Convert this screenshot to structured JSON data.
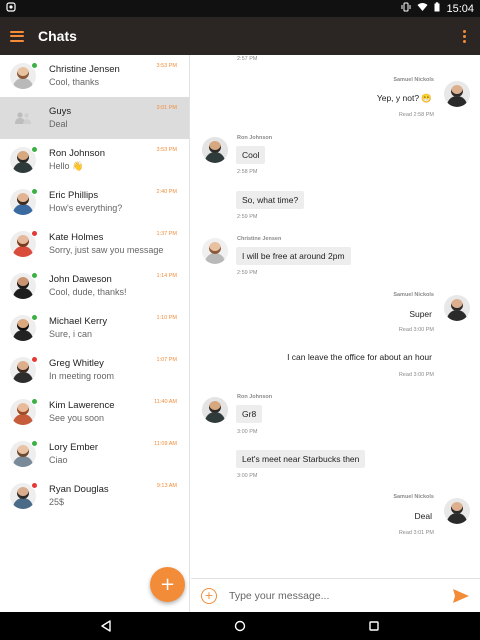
{
  "status_bar": {
    "time": "15:04"
  },
  "app_bar": {
    "title": "Chats"
  },
  "chats": [
    {
      "name": "Christine Jensen",
      "preview": "Cool, thanks",
      "time": "3:53 PM",
      "status": "#3cb043",
      "skin": "#e8c2a0",
      "shirt": "#b9b9b9",
      "hair": "#8a5a3b"
    },
    {
      "name": "Guys",
      "preview": "Deal",
      "time": "3:01 PM",
      "group": true
    },
    {
      "name": "Ron Johnson",
      "preview": "Hello 👋",
      "time": "3:53 PM",
      "status": "#3cb043",
      "skin": "#d7a77f",
      "shirt": "#2f3b3a",
      "hair": "#2a2a2a"
    },
    {
      "name": "Eric Phillips",
      "preview": "How's everything?",
      "time": "2:40 PM",
      "status": "#3cb043",
      "skin": "#e1b493",
      "shirt": "#3b6aa0",
      "hair": "#3d2b1f"
    },
    {
      "name": "Kate Holmes",
      "preview": "Sorry, just saw you message",
      "time": "1:37 PM",
      "status": "#e53935",
      "skin": "#e6b89c",
      "shirt": "#d94b3a",
      "hair": "#7a3a1d"
    },
    {
      "name": "John Daweson",
      "preview": "Cool, dude, thanks!",
      "time": "1:14 PM",
      "status": "#3cb043",
      "skin": "#c99472",
      "shirt": "#1d1d1d",
      "hair": "#1a1a1a"
    },
    {
      "name": "Michael Kerry",
      "preview": "Sure, i can",
      "time": "1:10 PM",
      "status": "#3cb043",
      "skin": "#d9a87f",
      "shirt": "#222222",
      "hair": "#111111"
    },
    {
      "name": "Greg Whitley",
      "preview": "In meeting room",
      "time": "1:07 PM",
      "status": "#e53935",
      "skin": "#dcae8c",
      "shirt": "#2d2d2d",
      "hair": "#3a2a20"
    },
    {
      "name": "Kim Lawerence",
      "preview": "See you soon",
      "time": "11:40 AM",
      "status": "#3cb043",
      "skin": "#e8bb9b",
      "shirt": "#c55c3a",
      "hair": "#9c4b23"
    },
    {
      "name": "Lory Ember",
      "preview": "Ciao",
      "time": "11:09 AM",
      "status": "#3cb043",
      "skin": "#e9c3a4",
      "shirt": "#7a8a99",
      "hair": "#6a4a30"
    },
    {
      "name": "Ryan Douglas",
      "preview": "25$",
      "time": "9:13 AM",
      "status": "#e53935",
      "skin": "#d9ad8d",
      "shirt": "#4a6b88",
      "hair": "#2c2c2c"
    }
  ],
  "conversation": {
    "top_time": "2:57 PM",
    "messages": [
      {
        "sender": "Samuel Nickols",
        "text": "Yep, y not? 😁",
        "meta": "Read 2:58 PM"
      },
      {
        "sender": "Ron Johnson",
        "text": "Cool",
        "meta": "2:58 PM"
      },
      {
        "text": "So, what time?",
        "meta": "2:59 PM"
      },
      {
        "sender": "Christine Jensen",
        "text": "I will be free at around 2pm",
        "meta": "2:59 PM"
      },
      {
        "sender": "Samuel Nickols",
        "text": "Super",
        "meta": "Read 3:00 PM"
      },
      {
        "text": "I can leave the office for about an hour",
        "meta": "Read 3:00 PM"
      },
      {
        "sender": "Ron Johnson",
        "text": "Gr8",
        "meta": "3:00 PM"
      },
      {
        "text": "Let's meet near  Starbucks then",
        "meta": "3:00 PM"
      },
      {
        "sender": "Samuel Nickols",
        "text": "Deal",
        "meta": "Read 3:01 PM"
      }
    ]
  },
  "compose": {
    "placeholder": "Type your message..."
  },
  "colors": {
    "accent": "#f28c38",
    "app_bar": "#2b2624",
    "online": "#3cb043",
    "busy": "#e53935"
  },
  "icons": {
    "menu": "hamburger-menu-icon",
    "overflow": "overflow-menu-icon",
    "add": "add-icon",
    "send": "send-icon",
    "back": "back-icon",
    "home": "home-icon",
    "recents": "recents-icon"
  }
}
